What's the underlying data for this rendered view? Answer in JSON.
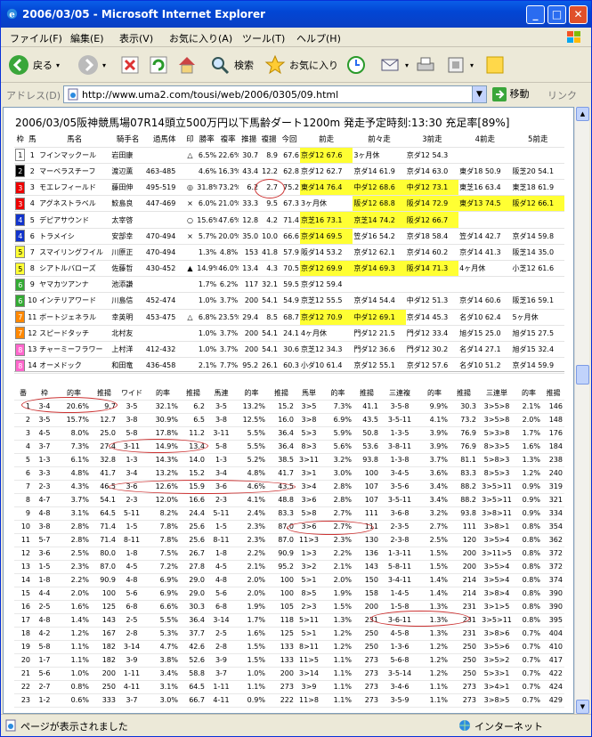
{
  "window": {
    "title": "2006/03/05 - Microsoft Internet Explorer",
    "min": "_",
    "max": "□",
    "close": "✕"
  },
  "menu": [
    "ファイル(F)",
    "編集(E)",
    "表示(V)",
    "お気に入り(A)",
    "ツール(T)",
    "ヘルプ(H)"
  ],
  "toolbar": {
    "back": "戻る",
    "search": "検索",
    "favorites": "お気に入り"
  },
  "address": {
    "label": "アドレス(D)",
    "url": "http://www.uma2.com/tousi/web/2006/0305/09.html",
    "go": "移動",
    "links": "リンク"
  },
  "status": {
    "text": "ページが表示されました",
    "zone": "インターネット"
  },
  "page": {
    "headline": "2006/03/05阪神競馬場07R14頭立500万円以下馬齢ダート1200m 発走予定時刻:13:30 充足率[89%]",
    "race_header": [
      "枠",
      "馬",
      "馬名",
      "騎手名",
      "過馬体",
      "印",
      "勝率",
      "複率",
      "推揚",
      "複揚",
      "今回",
      "前走",
      "前々走",
      "3前走",
      "4前走",
      "5前走"
    ],
    "horses": [
      {
        "w": "1",
        "n": "1",
        "name": "フインマックール",
        "jockey": "岩田康",
        "body": "",
        "mark": "△",
        "win": "6.5%",
        "place": "22.6%",
        "r1": "30.7",
        "r2": "8.9",
        "now": "67.6",
        "p1": "京ダ12 67.6",
        "p2": "3ヶ月休",
        "p3": "京ダ12 54.3",
        "p4": "",
        "p5": "",
        "hl": [
          1
        ]
      },
      {
        "w": "2",
        "n": "2",
        "name": "マーベラスチーフ",
        "jockey": "渡辺薫",
        "body": "463-485",
        "mark": "",
        "win": "4.6%",
        "place": "16.3%",
        "r1": "43.4",
        "r2": "12.2",
        "now": "62.8",
        "p1": "京ダ12 62.7",
        "p2": "京ダ14 61.9",
        "p3": "京ダ14 63.0",
        "p4": "東ダ18 50.9",
        "p5": "阪芝20 54.1",
        "hl": []
      },
      {
        "w": "3",
        "n": "3",
        "name": "モエレフィールド",
        "jockey": "藤田伸",
        "body": "495-519",
        "mark": "◎",
        "win": "31.8%",
        "place": "73.2%",
        "r1": "6.2",
        "r2": "2.7",
        "now": "75.2",
        "p1": "東ダ14 76.4",
        "p2": "中ダ12 68.6",
        "p3": "中ダ12 73.1",
        "p4": "東芝16 63.4",
        "p5": "東芝18 61.9",
        "hl": [
          1,
          2,
          3
        ]
      },
      {
        "w": "3",
        "n": "4",
        "name": "アグネストラベル",
        "jockey": "鮫島良",
        "body": "447-469",
        "mark": "×",
        "win": "6.0%",
        "place": "21.0%",
        "r1": "33.3",
        "r2": "9.5",
        "now": "67.3",
        "p1": "3ヶ月休",
        "p2": "阪ダ12 68.8",
        "p3": "阪ダ14 72.9",
        "p4": "東ダ13 74.5",
        "p5": "阪ダ12 66.1",
        "hl": [
          2,
          3,
          4,
          5
        ]
      },
      {
        "w": "4",
        "n": "5",
        "name": "デピアサウンド",
        "jockey": "太宰啓",
        "body": "",
        "mark": "○",
        "win": "15.6%",
        "place": "47.6%",
        "r1": "12.8",
        "r2": "4.2",
        "now": "71.4",
        "p1": "京芝16 73.1",
        "p2": "京芝14 74.2",
        "p3": "阪ダ12 66.7",
        "p4": "",
        "p5": "",
        "hl": [
          1,
          2,
          3
        ]
      },
      {
        "w": "4",
        "n": "6",
        "name": "トラメイシ",
        "jockey": "安部幸",
        "body": "470-494",
        "mark": "×",
        "win": "5.7%",
        "place": "20.0%",
        "r1": "35.0",
        "r2": "10.0",
        "now": "66.6",
        "p1": "京ダ14 69.5",
        "p2": "笠ダ16 54.2",
        "p3": "京ダ18 58.4",
        "p4": "笠ダ14 42.7",
        "p5": "京ダ14 59.8",
        "hl": [
          1
        ]
      },
      {
        "w": "5",
        "n": "7",
        "name": "スマイリングフイル",
        "jockey": "川原正",
        "body": "470-494",
        "mark": "",
        "win": "1.3%",
        "place": "4.8%",
        "r1": "153",
        "r2": "41.8",
        "now": "57.9",
        "p1": "阪ダ14 53.2",
        "p2": "京ダ12 62.1",
        "p3": "京ダ14 60.2",
        "p4": "京ダ14 41.3",
        "p5": "阪芝14 35.0",
        "hl": []
      },
      {
        "w": "5",
        "n": "8",
        "name": "シアトルバローズ",
        "jockey": "佐藤哲",
        "body": "430-452",
        "mark": "▲",
        "win": "14.9%",
        "place": "46.0%",
        "r1": "13.4",
        "r2": "4.3",
        "now": "70.5",
        "p1": "京ダ12 69.9",
        "p2": "京ダ14 69.3",
        "p3": "阪ダ14 71.3",
        "p4": "4ヶ月休",
        "p5": "小芝12 61.6",
        "hl": [
          1,
          2,
          3
        ]
      },
      {
        "w": "6",
        "n": "9",
        "name": "ヤマカツアンナ",
        "jockey": "池添謙",
        "body": "",
        "mark": "",
        "win": "1.7%",
        "place": "6.2%",
        "r1": "117",
        "r2": "32.1",
        "now": "59.5",
        "p1": "京ダ12 59.4",
        "p2": "",
        "p3": "",
        "p4": "",
        "p5": "",
        "hl": []
      },
      {
        "w": "6",
        "n": "10",
        "name": "インテリアワード",
        "jockey": "川島信",
        "body": "452-474",
        "mark": "",
        "win": "1.0%",
        "place": "3.7%",
        "r1": "200",
        "r2": "54.1",
        "now": "54.9",
        "p1": "京芝12 55.5",
        "p2": "京ダ14 54.4",
        "p3": "中ダ12 51.3",
        "p4": "京ダ14 60.6",
        "p5": "阪芝16 59.1",
        "hl": []
      },
      {
        "w": "7",
        "n": "11",
        "name": "ボートジェネラル",
        "jockey": "幸英明",
        "body": "453-475",
        "mark": "△",
        "win": "6.8%",
        "place": "23.5%",
        "r1": "29.4",
        "r2": "8.5",
        "now": "68.7",
        "p1": "京ダ12 70.9",
        "p2": "中ダ12 69.1",
        "p3": "京ダ14 45.3",
        "p4": "名ダ10 62.4",
        "p5": "5ヶ月休",
        "hl": [
          1,
          2
        ]
      },
      {
        "w": "7",
        "n": "12",
        "name": "スピードタッチ",
        "jockey": "北村友",
        "body": "",
        "mark": "",
        "win": "1.0%",
        "place": "3.7%",
        "r1": "200",
        "r2": "54.1",
        "now": "24.1",
        "p1": "4ヶ月休",
        "p2": "門ダ12 21.5",
        "p3": "門ダ12 33.4",
        "p4": "旭ダ15 25.0",
        "p5": "旭ダ15 27.5",
        "hl": []
      },
      {
        "w": "8",
        "n": "13",
        "name": "チャーミーフラワー",
        "jockey": "上村洋",
        "body": "412-432",
        "mark": "",
        "win": "1.0%",
        "place": "3.7%",
        "r1": "200",
        "r2": "54.1",
        "now": "30.6",
        "p1": "京芝12 34.3",
        "p2": "門ダ12 36.6",
        "p3": "門ダ12 30.2",
        "p4": "名ダ14 27.1",
        "p5": "旭ダ15 32.4",
        "hl": []
      },
      {
        "w": "8",
        "n": "14",
        "name": "オーメドック",
        "jockey": "和田竜",
        "body": "436-458",
        "mark": "",
        "win": "2.1%",
        "place": "7.7%",
        "r1": "95.2",
        "r2": "26.1",
        "now": "60.3",
        "p1": "小ダ10 61.4",
        "p2": "京ダ12 55.1",
        "p3": "京ダ12 57.6",
        "p4": "名ダ10 51.2",
        "p5": "京ダ14 59.9",
        "hl": []
      }
    ],
    "odds_header": [
      "番",
      "枠",
      "的率",
      "推揚",
      "ワイド",
      "的率",
      "推揚",
      "馬連",
      "的率",
      "推揚",
      "馬単",
      "的率",
      "推揚",
      "三連複",
      "的率",
      "推揚",
      "三連単",
      "的率",
      "推揚"
    ],
    "odds": [
      [
        "1",
        "3-4",
        "20.6%",
        "9.7",
        "3-5",
        "32.1%",
        "6.2",
        "3-5",
        "13.2%",
        "15.2",
        "3>5",
        "7.3%",
        "41.1",
        "3-5-8",
        "9.9%",
        "30.3",
        "3>5>8",
        "2.1%",
        "146"
      ],
      [
        "2",
        "3-5",
        "15.7%",
        "12.7",
        "3-8",
        "30.9%",
        "6.5",
        "3-8",
        "12.5%",
        "16.0",
        "3>8",
        "6.9%",
        "43.5",
        "3-5-11",
        "4.1%",
        "73.2",
        "3>5>8",
        "2.0%",
        "148"
      ],
      [
        "3",
        "4-5",
        "8.0%",
        "25.0",
        "5-8",
        "17.8%",
        "11.2",
        "3-11",
        "5.5%",
        "36.4",
        "5>3",
        "5.9%",
        "50.8",
        "1-3-5",
        "3.9%",
        "76.9",
        "5>3>8",
        "1.7%",
        "176"
      ],
      [
        "4",
        "3-7",
        "7.3%",
        "27.4",
        "3-11",
        "14.9%",
        "13.4",
        "5-8",
        "5.5%",
        "36.4",
        "8>3",
        "5.6%",
        "53.6",
        "3-8-11",
        "3.9%",
        "76.9",
        "8>3>5",
        "1.6%",
        "184"
      ],
      [
        "5",
        "1-3",
        "6.1%",
        "32.8",
        "1-3",
        "14.3%",
        "14.0",
        "1-3",
        "5.2%",
        "38.5",
        "3>11",
        "3.2%",
        "93.8",
        "1-3-8",
        "3.7%",
        "81.1",
        "5>8>3",
        "1.3%",
        "238"
      ],
      [
        "6",
        "3-3",
        "4.8%",
        "41.7",
        "3-4",
        "13.2%",
        "15.2",
        "3-4",
        "4.8%",
        "41.7",
        "3>1",
        "3.0%",
        "100",
        "3-4-5",
        "3.6%",
        "83.3",
        "8>5>3",
        "1.2%",
        "240"
      ],
      [
        "7",
        "2-3",
        "4.3%",
        "46.5",
        "3-6",
        "12.6%",
        "15.9",
        "3-6",
        "4.6%",
        "43.5",
        "3>4",
        "2.8%",
        "107",
        "3-5-6",
        "3.4%",
        "88.2",
        "3>5>11",
        "0.9%",
        "319"
      ],
      [
        "8",
        "4-7",
        "3.7%",
        "54.1",
        "2-3",
        "12.0%",
        "16.6",
        "2-3",
        "4.1%",
        "48.8",
        "3>6",
        "2.8%",
        "107",
        "3-5-11",
        "3.4%",
        "88.2",
        "3>5>11",
        "0.9%",
        "321"
      ],
      [
        "9",
        "4-8",
        "3.1%",
        "64.5",
        "5-11",
        "8.2%",
        "24.4",
        "5-11",
        "2.4%",
        "83.3",
        "5>8",
        "2.7%",
        "111",
        "3-6-8",
        "3.2%",
        "93.8",
        "3>8>11",
        "0.9%",
        "334"
      ],
      [
        "10",
        "3-8",
        "2.8%",
        "71.4",
        "1-5",
        "7.8%",
        "25.6",
        "1-5",
        "2.3%",
        "87.0",
        "3>6",
        "2.7%",
        "111",
        "2-3-5",
        "2.7%",
        "111",
        "3>8>1",
        "0.8%",
        "354"
      ],
      [
        "11",
        "5-7",
        "2.8%",
        "71.4",
        "8-11",
        "7.8%",
        "25.6",
        "8-11",
        "2.3%",
        "87.0",
        "11>3",
        "2.3%",
        "130",
        "2-3-8",
        "2.5%",
        "120",
        "3>5>4",
        "0.8%",
        "362"
      ],
      [
        "12",
        "3-6",
        "2.5%",
        "80.0",
        "1-8",
        "7.5%",
        "26.7",
        "1-8",
        "2.2%",
        "90.9",
        "1>3",
        "2.2%",
        "136",
        "1-3-11",
        "1.5%",
        "200",
        "3>11>5",
        "0.8%",
        "372"
      ],
      [
        "13",
        "1-5",
        "2.3%",
        "87.0",
        "4-5",
        "7.2%",
        "27.8",
        "4-5",
        "2.1%",
        "95.2",
        "3>2",
        "2.1%",
        "143",
        "5-8-11",
        "1.5%",
        "200",
        "3>5>4",
        "0.8%",
        "372"
      ],
      [
        "14",
        "1-8",
        "2.2%",
        "90.9",
        "4-8",
        "6.9%",
        "29.0",
        "4-8",
        "2.0%",
        "100",
        "5>1",
        "2.0%",
        "150",
        "3-4-11",
        "1.4%",
        "214",
        "3>5>4",
        "0.8%",
        "374"
      ],
      [
        "15",
        "4-4",
        "2.0%",
        "100",
        "5-6",
        "6.9%",
        "29.0",
        "5-6",
        "2.0%",
        "100",
        "8>5",
        "1.9%",
        "158",
        "1-4-5",
        "1.4%",
        "214",
        "3>8>4",
        "0.8%",
        "390"
      ],
      [
        "16",
        "2-5",
        "1.6%",
        "125",
        "6-8",
        "6.6%",
        "30.3",
        "6-8",
        "1.9%",
        "105",
        "2>3",
        "1.5%",
        "200",
        "1-5-8",
        "1.3%",
        "231",
        "3>1>5",
        "0.8%",
        "390"
      ],
      [
        "17",
        "4-8",
        "1.4%",
        "143",
        "2-5",
        "5.5%",
        "36.4",
        "3-14",
        "1.7%",
        "118",
        "5>11",
        "1.3%",
        "231",
        "3-6-11",
        "1.3%",
        "231",
        "3>5>11",
        "0.8%",
        "395"
      ],
      [
        "18",
        "4-2",
        "1.2%",
        "167",
        "2-8",
        "5.3%",
        "37.7",
        "2-5",
        "1.6%",
        "125",
        "5>1",
        "1.2%",
        "250",
        "4-5-8",
        "1.3%",
        "231",
        "3>8>6",
        "0.7%",
        "404"
      ],
      [
        "19",
        "5-8",
        "1.1%",
        "182",
        "3-14",
        "4.7%",
        "42.6",
        "2-8",
        "1.5%",
        "133",
        "8>11",
        "1.2%",
        "250",
        "1-3-6",
        "1.2%",
        "250",
        "3>5>6",
        "0.7%",
        "410"
      ],
      [
        "20",
        "1-7",
        "1.1%",
        "182",
        "3-9",
        "3.8%",
        "52.6",
        "3-9",
        "1.5%",
        "133",
        "11>5",
        "1.1%",
        "273",
        "5-6-8",
        "1.2%",
        "250",
        "3>5>2",
        "0.7%",
        "417"
      ],
      [
        "21",
        "5-6",
        "1.0%",
        "200",
        "1-11",
        "3.4%",
        "58.8",
        "3-7",
        "1.0%",
        "200",
        "3>14",
        "1.1%",
        "273",
        "3-5-14",
        "1.2%",
        "250",
        "5>3>1",
        "0.7%",
        "422"
      ],
      [
        "22",
        "2-7",
        "0.8%",
        "250",
        "4-11",
        "3.1%",
        "64.5",
        "1-11",
        "1.1%",
        "273",
        "3>9",
        "1.1%",
        "273",
        "3-4-6",
        "1.1%",
        "273",
        "3>4>1",
        "0.7%",
        "424"
      ],
      [
        "23",
        "1-2",
        "0.6%",
        "333",
        "3-7",
        "3.0%",
        "66.7",
        "4-11",
        "0.9%",
        "222",
        "11>8",
        "1.1%",
        "273",
        "3-5-9",
        "1.1%",
        "273",
        "3>8>5",
        "0.7%",
        "429"
      ]
    ]
  }
}
